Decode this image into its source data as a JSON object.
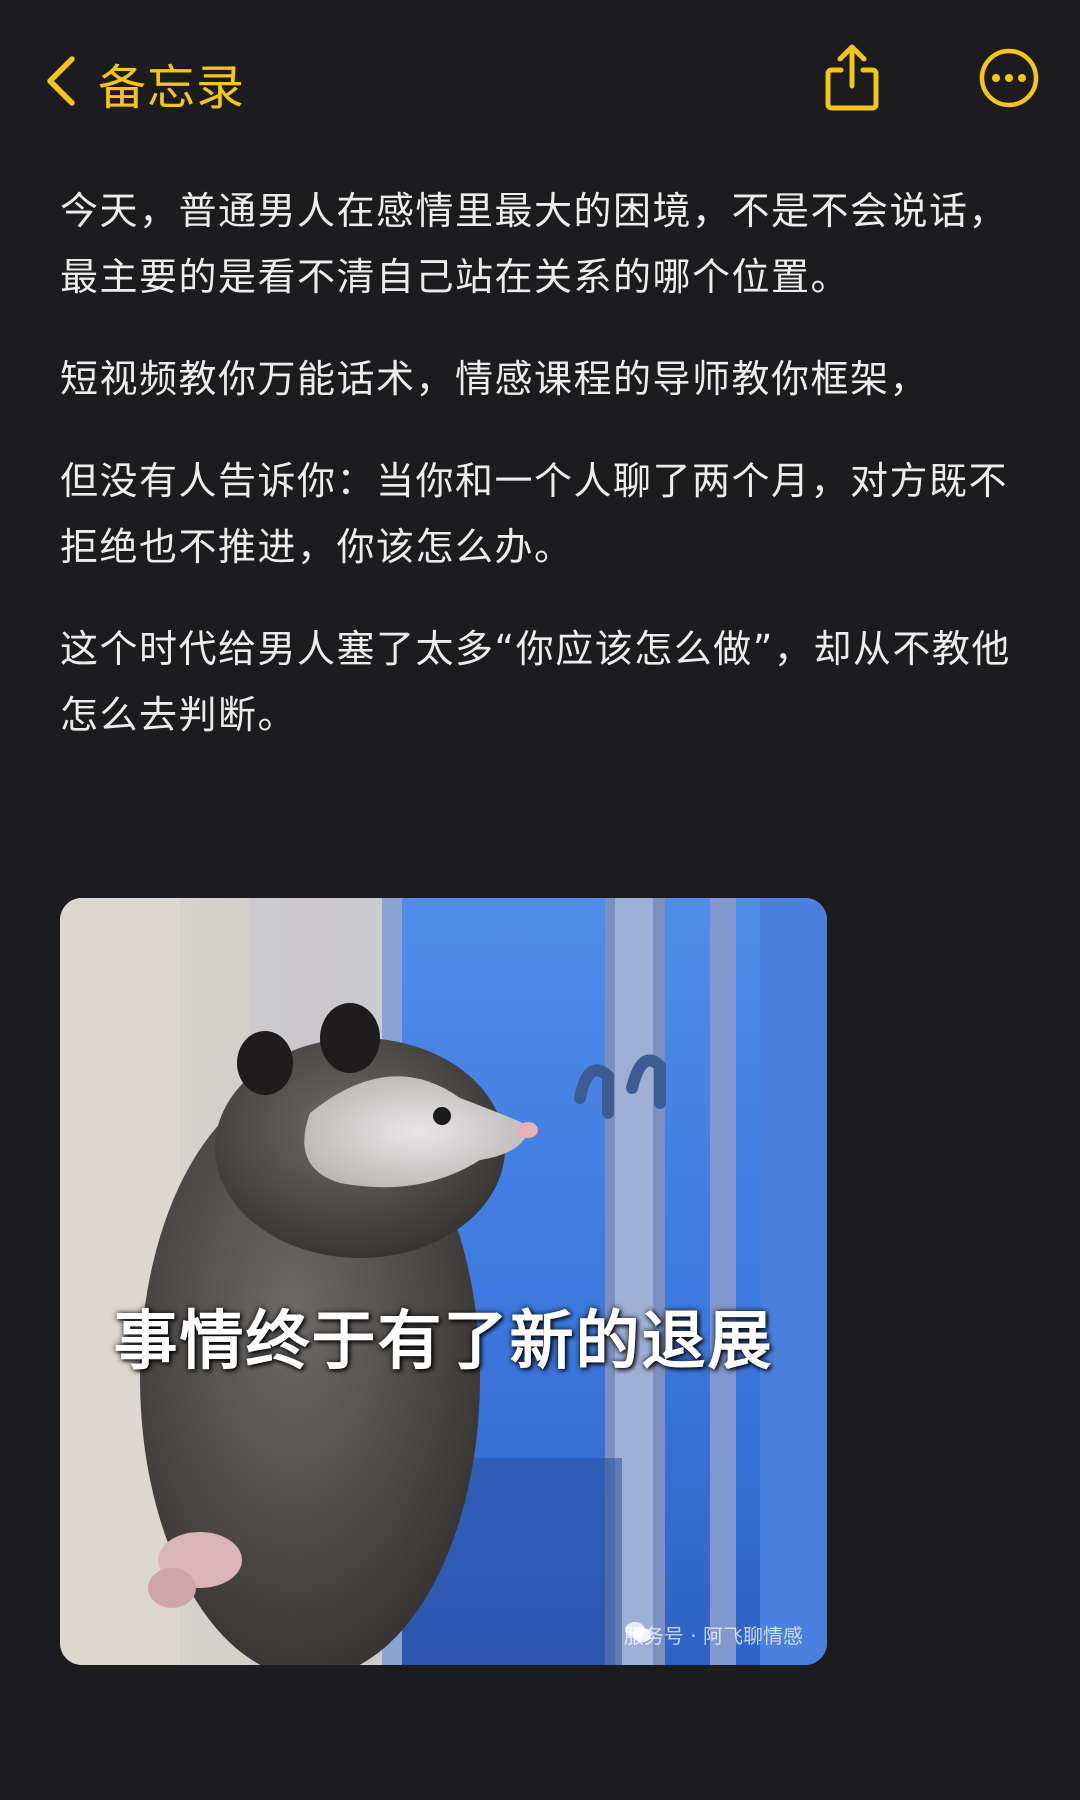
{
  "nav": {
    "back_label": "备忘录",
    "back_icon": "chevron-left-icon",
    "share_icon": "share-icon",
    "more_icon": "more-icon"
  },
  "note": {
    "paragraphs": [
      "今天，普通男人在感情里最大的困境，不是不会说话，最主要的是看不清自己站在关系的哪个位置。",
      "短视频教你万能话术，情感课程的导师教你框架，",
      "但没有人告诉你：当你和一个人聊了两个月，对方既不拒绝也不推进，你该怎么办。",
      "这个时代给男人塞了太多“你应该怎么做”，却从不教他怎么去判断。"
    ]
  },
  "image": {
    "caption": "事情终于有了新的退展",
    "watermark": "服务号 · 阿飞聊情感",
    "watermark_icon": "wechat-icon"
  },
  "colors": {
    "background": "#1c1c1e",
    "accent": "#f5c518",
    "text": "#ececec"
  }
}
